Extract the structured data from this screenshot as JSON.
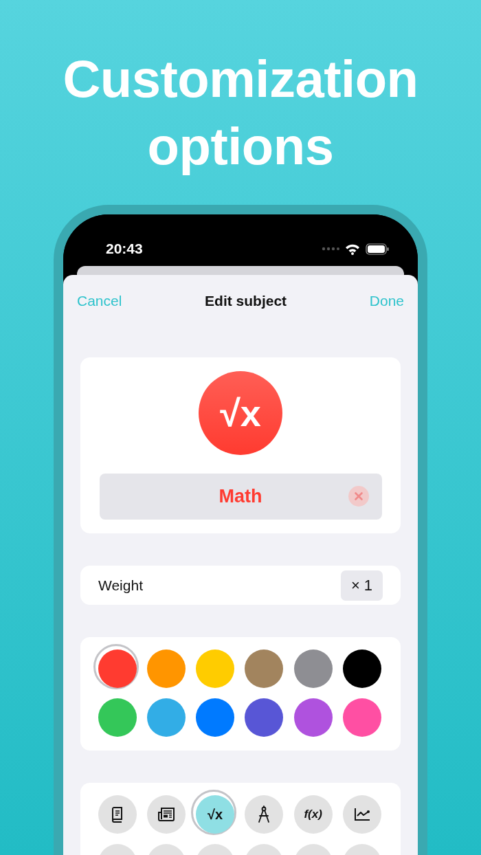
{
  "headline": "Customization options",
  "status_bar": {
    "time": "20:43"
  },
  "nav": {
    "cancel": "Cancel",
    "title": "Edit subject",
    "done": "Done"
  },
  "subject": {
    "glyph": "√x",
    "color": "#ff3b30",
    "name": "Math"
  },
  "weight": {
    "label": "Weight",
    "value": "× 1"
  },
  "colors": [
    {
      "color": "#ff3b30",
      "selected": true
    },
    {
      "color": "#ff9500",
      "selected": false
    },
    {
      "color": "#ffcc00",
      "selected": false
    },
    {
      "color": "#a2845e",
      "selected": false
    },
    {
      "color": "#8e8e93",
      "selected": false
    },
    {
      "color": "#000000",
      "selected": false
    },
    {
      "color": "#34c759",
      "selected": false
    },
    {
      "color": "#32ade6",
      "selected": false
    },
    {
      "color": "#007aff",
      "selected": false
    },
    {
      "color": "#5856d6",
      "selected": false
    },
    {
      "color": "#af52de",
      "selected": false
    },
    {
      "color": "#ff4fa3",
      "selected": false
    }
  ],
  "icons": [
    {
      "kind": "book",
      "selected": false
    },
    {
      "kind": "newspaper",
      "selected": false
    },
    {
      "kind": "glyph",
      "glyph": "√x",
      "selected": true
    },
    {
      "kind": "compass",
      "selected": false
    },
    {
      "kind": "glyph",
      "glyph": "f(x)",
      "selected": false
    },
    {
      "kind": "chart",
      "selected": false
    },
    {
      "kind": "hidden",
      "selected": false
    },
    {
      "kind": "hidden",
      "selected": false
    },
    {
      "kind": "hidden",
      "selected": false
    },
    {
      "kind": "hidden",
      "selected": false
    },
    {
      "kind": "hidden",
      "selected": false
    },
    {
      "kind": "hidden",
      "selected": false
    }
  ]
}
